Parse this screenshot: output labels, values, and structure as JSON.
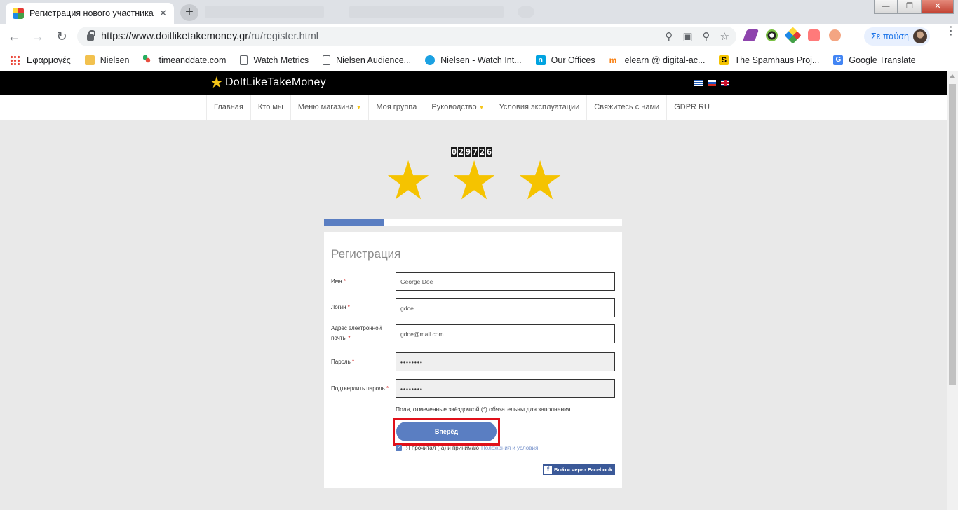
{
  "browser": {
    "tab_title": "Регистрация нового участника",
    "tab_close": "✕",
    "new_tab": "+",
    "url_host": "https://www.doitliketakemoney.gr",
    "url_path": "/ru/register.html",
    "profile_label": "Σε παύση",
    "window_controls": [
      "—",
      "❐",
      "✕"
    ]
  },
  "bookmarks": [
    {
      "label": "Εφαρμογές",
      "icon": "apps-grid-icon",
      "color": "#ea4335"
    },
    {
      "label": "Nielsen",
      "icon": "folder-icon",
      "color": "#f2c14e"
    },
    {
      "label": "timeanddate.com",
      "icon": "timeanddate-icon",
      "color": "#e84c3d"
    },
    {
      "label": "Watch Metrics",
      "icon": "page-icon",
      "color": "#ffffff"
    },
    {
      "label": "Nielsen Audience...",
      "icon": "page-icon",
      "color": "#ffffff"
    },
    {
      "label": "Nielsen - Watch Int...",
      "icon": "nielsen-icon",
      "color": "#1ba1e2"
    },
    {
      "label": "Our Offices",
      "icon": "n-logo-icon",
      "color": "#00a3e0"
    },
    {
      "label": "elearn @ digital-ac...",
      "icon": "moodle-icon",
      "color": "#f98012"
    },
    {
      "label": "The Spamhaus Proj...",
      "icon": "spamhaus-icon",
      "color": "#f4c300"
    },
    {
      "label": "Google Translate",
      "icon": "google-translate-icon",
      "color": "#4285f4"
    }
  ],
  "site": {
    "logo_text": "DoItLikeTakeMoney",
    "nav": [
      {
        "label": "Главная",
        "caret": false
      },
      {
        "label": "Кто мы",
        "caret": false
      },
      {
        "label": "Меню магазина",
        "caret": true
      },
      {
        "label": "Моя группа",
        "caret": false
      },
      {
        "label": "Руководство",
        "caret": true
      },
      {
        "label": "Условия эксплуатации",
        "caret": false
      },
      {
        "label": "Свяжитесь с нами",
        "caret": false
      },
      {
        "label": "GDPR RU",
        "caret": false
      }
    ],
    "counter": "029726",
    "step_progress": 0.2
  },
  "form": {
    "title": "Регистрация",
    "required_mark": "*",
    "fields": [
      {
        "label": "Имя",
        "value": "George Doe",
        "type": "text"
      },
      {
        "label": "Логин",
        "value": "gdoe",
        "type": "text"
      },
      {
        "label": "Адрес электронной почты",
        "value": "gdoe@mail.com",
        "type": "text"
      },
      {
        "label": "Пароль",
        "value": "••••••••",
        "type": "password"
      },
      {
        "label": "Подтвердить пароль",
        "value": "••••••••",
        "type": "password"
      }
    ],
    "note_before": "Поля, отмеченные звёздочкой (",
    "note_mark": "*",
    "note_after": ") обязательны для заполнения.",
    "next_button": "Вперёд",
    "terms_text": "Я прочитал (-а) и принимаю",
    "terms_link": "Положения и условия.",
    "facebook_button": "Войти через Facebook",
    "facebook_glyph": "f",
    "terms_checked": true
  },
  "colors": {
    "accent": "#5a7ec2",
    "star": "#f5c300",
    "highlight": "#e0101a"
  }
}
